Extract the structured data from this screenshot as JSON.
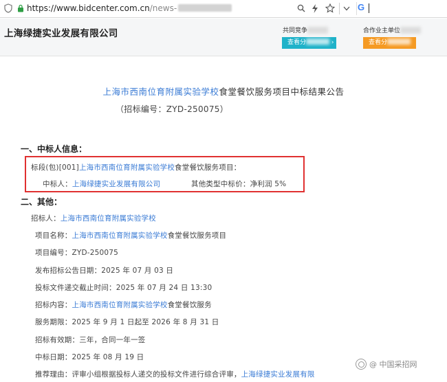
{
  "browser": {
    "url_main": "https://www.bidcenter.com.cn",
    "url_path": "/news-",
    "search_engine_glyph": "G",
    "icons": [
      "shield-icon",
      "lock-icon",
      "search-icon",
      "lightning-icon",
      "star-icon",
      "chevron-down-icon"
    ]
  },
  "header": {
    "company_name": "上海绿捷实业发展有限公司",
    "left_label": "共同竞争",
    "left_button": "查看分",
    "right_label": "合作业主单位",
    "right_button": "查看分"
  },
  "announcement": {
    "title_link": "上海市西南位育附属实验学校",
    "title_rest": "食堂餐饮服务项目中标结果公告",
    "code": "（招标编号：ZYD-250075）"
  },
  "section1": {
    "heading": "一、中标人信息：",
    "lot_prefix": "标段(包)[001]",
    "lot_link": "上海市西南位育附属实验学校",
    "lot_suffix": "食堂餐饮服务项目：",
    "winner_label": "中标人：",
    "winner_link": "上海绿捷实业发展有限公司",
    "price_label": "其他类型中标价：",
    "price_value": "净利润 5%"
  },
  "section2": {
    "heading": "二、其他：",
    "tenderer_label": "招标人：",
    "tenderer_link": "上海市西南位育附属实验学校",
    "project_name_label": "项目名称：",
    "project_name_link": "上海市西南位育附属实验学校",
    "project_name_suffix": "食堂餐饮服务项目",
    "project_no": "项目编号：ZYD-250075",
    "publish_date": "发布招标公告日期：2025 年 07 月 03 日",
    "deadline": "投标文件递交截止时间：2025 年 07 月 24 日 13:30",
    "content_label": "招标内容：",
    "content_link": "上海市西南位育附属实验学校",
    "content_suffix": "食堂餐饮服务",
    "service_period": "服务期限：2025 年 9 月 1 日起至 2026 年 8 月 31 日",
    "validity": "招标有效期：三年，合同一年一签",
    "award_date": "中标日期：2025 年 08 月 19 日",
    "reason_prefix": "推荐理由：评审小组根据投标人递交的投标文件进行综合评审，",
    "reason_link": "上海绿捷实业发展有限"
  },
  "watermark": {
    "text": "@ 中国采招网"
  },
  "colors": {
    "link": "#3a7bd5",
    "highlight_border": "#e03030",
    "button_teal": "#1fb2c9",
    "button_orange": "#f59a23",
    "url_lock_green": "#2e9e44"
  }
}
